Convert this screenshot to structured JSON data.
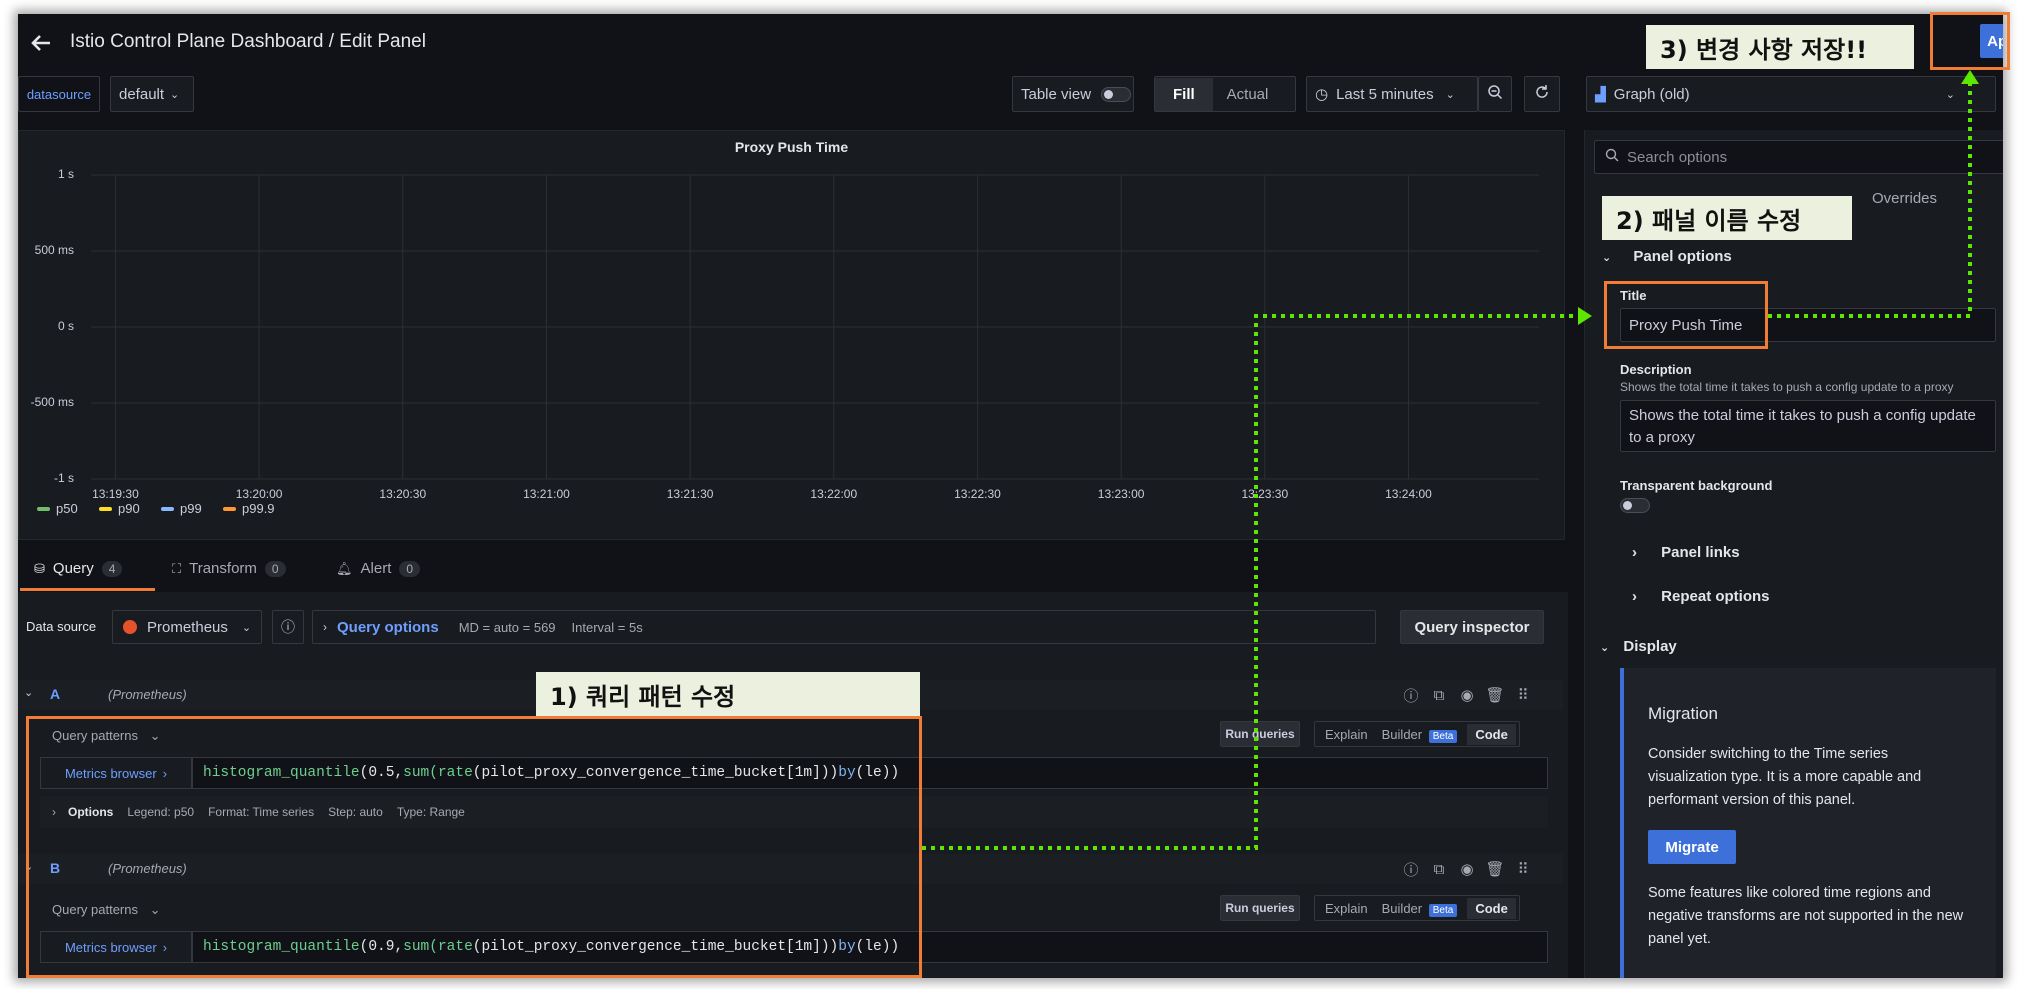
{
  "header": {
    "title": "Istio Control Plane Dashboard / Edit Panel",
    "apply_label": "Apply",
    "back_icon": "arrow-left-icon"
  },
  "toolbar": {
    "datasource_var_label": "datasource",
    "datasource_var_value": "default",
    "table_view_label": "Table view",
    "fill_label": "Fill",
    "actual_label": "Actual",
    "time_range": "Last 5 minutes",
    "visualization": "Graph (old)"
  },
  "chart_data": {
    "type": "line",
    "title": "Proxy Push Time",
    "y_ticks": [
      "1 s",
      "500 ms",
      "0 s",
      "-500 ms",
      "-1 s"
    ],
    "x_ticks": [
      "13:19:30",
      "13:20:00",
      "13:20:30",
      "13:21:00",
      "13:21:30",
      "13:22:00",
      "13:22:30",
      "13:23:00",
      "13:23:30",
      "13:24:00"
    ],
    "ylim": [
      -1,
      1
    ],
    "grid": true,
    "legend_position": "bottom-left",
    "series": [
      {
        "name": "p50",
        "values": [],
        "color": "#73bf69"
      },
      {
        "name": "p90",
        "values": [],
        "color": "#fade2a"
      },
      {
        "name": "p99",
        "values": [],
        "color": "#8ab8ff"
      },
      {
        "name": "p99.9",
        "values": [],
        "color": "#ff9830"
      }
    ]
  },
  "tabs": [
    {
      "label": "Query",
      "count": "4"
    },
    {
      "label": "Transform",
      "count": "0"
    },
    {
      "label": "Alert",
      "count": "0"
    }
  ],
  "query_bar": {
    "data_source_label": "Data source",
    "data_source_value": "Prometheus",
    "query_options_label": "Query options",
    "md_text": "MD = auto = 569",
    "interval_text": "Interval = 5s",
    "inspector_label": "Query inspector"
  },
  "queries": [
    {
      "ref": "A",
      "source": "(Prometheus)",
      "patterns_label": "Query patterns",
      "run_label": "Run queries",
      "explain_label": "Explain",
      "builder_label": "Builder",
      "beta_label": "Beta",
      "code_label": "Code",
      "metrics_label": "Metrics browser",
      "expr_func": "histogram_quantile",
      "expr_mid": "(0.5, ",
      "expr_sum": "sum",
      "expr_rate": "(rate",
      "expr_metric": "(pilot_proxy_convergence_time_bucket[1m])) ",
      "expr_by": "by",
      "expr_end": " (le))",
      "options_label": "Options",
      "legend": "Legend: p50",
      "format": "Format: Time series",
      "step": "Step: auto",
      "qtype": "Type: Range"
    },
    {
      "ref": "B",
      "source": "(Prometheus)",
      "patterns_label": "Query patterns",
      "run_label": "Run queries",
      "explain_label": "Explain",
      "builder_label": "Builder",
      "beta_label": "Beta",
      "code_label": "Code",
      "metrics_label": "Metrics browser",
      "expr_func": "histogram_quantile",
      "expr_mid": "(0.9, ",
      "expr_sum": "sum",
      "expr_rate": "(rate",
      "expr_metric": "(pilot_proxy_convergence_time_bucket[1m])) ",
      "expr_by": "by",
      "expr_end": " (le))"
    }
  ],
  "options_pane": {
    "search_placeholder": "Search options",
    "overrides_tab": "Overrides",
    "panel_options_label": "Panel options",
    "title_label": "Title",
    "title_value": "Proxy Push Time",
    "description_label": "Description",
    "description_hint": "Shows the total time it takes to push a config update to a proxy",
    "description_value": "Shows the total time it takes to push a config update to a proxy",
    "transparent_label": "Transparent background",
    "panel_links_label": "Panel links",
    "repeat_options_label": "Repeat options",
    "display_label": "Display",
    "migration_title": "Migration",
    "migration_text": "Consider switching to the Time series visualization type. It is a more capable and performant version of this panel.",
    "migrate_label": "Migrate",
    "migration_note": "Some features like colored time regions and negative transforms are not supported in the new panel yet."
  },
  "annotations": {
    "step1": "1) 쿼리 패턴 수정",
    "step2": "2) 패널 이름 수정",
    "step3": "3) 변경 사항 저장!!",
    "accent_color": "#f07d35",
    "arrow_color": "#5ce600"
  }
}
